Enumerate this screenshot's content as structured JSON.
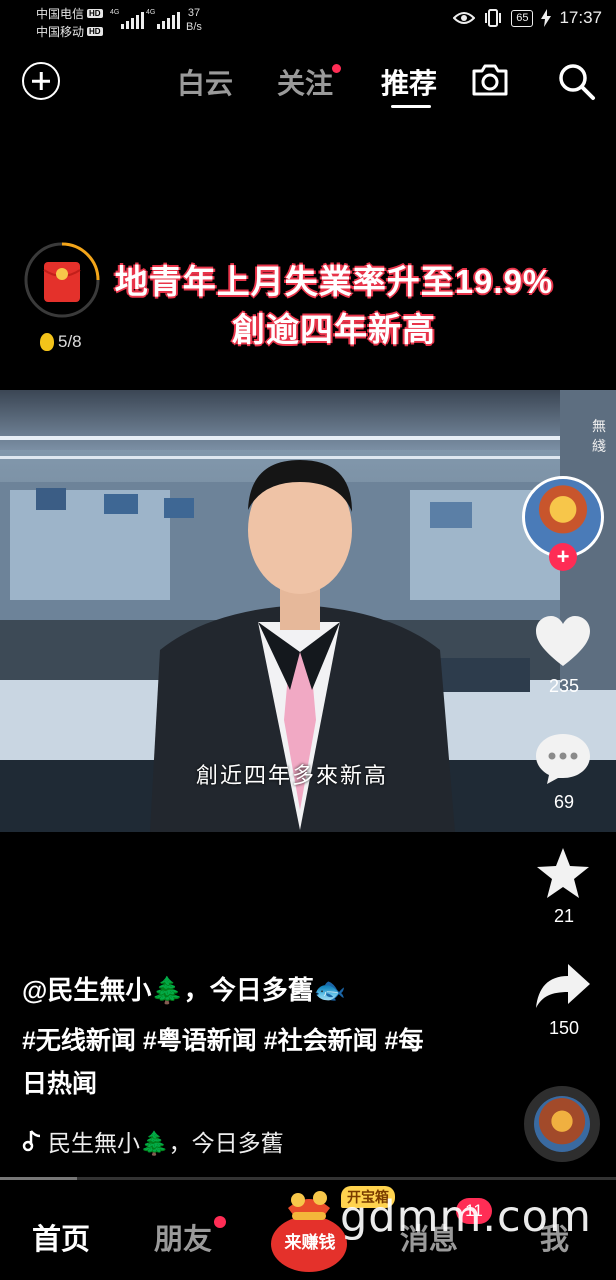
{
  "status_bar": {
    "carrier1": "中国电信",
    "carrier2": "中国移动",
    "hd_label": "HD",
    "network_tag": "4G",
    "net_speed_value": "37",
    "net_speed_unit": "B/s",
    "battery": "65",
    "time": "17:37"
  },
  "top_nav": {
    "tabs": [
      {
        "label": "白云",
        "active": false,
        "dot": false
      },
      {
        "label": "关注",
        "active": false,
        "dot": true
      },
      {
        "label": "推荐",
        "active": true,
        "dot": false
      }
    ]
  },
  "video": {
    "headline_line1": "地青年上月失業率升至19.9%",
    "headline_line2": "創逾四年新高",
    "coin_progress": "5/8",
    "subtitle": "創近四年多來新高",
    "channel_text": "無綫"
  },
  "actions": {
    "likes": "235",
    "comments": "69",
    "favorites": "21",
    "shares": "150",
    "follow_symbol": "+"
  },
  "caption": {
    "author": "@民生無小🌲，今日多舊🐟",
    "hashtags": "#无线新闻 #粤语新闻 #社会新闻 #每日热闻",
    "music": "民生無小🌲，今日多舊"
  },
  "playback": {
    "progress_fraction": 0.125
  },
  "bottom_nav": {
    "tabs": [
      {
        "label": "首页",
        "active": true
      },
      {
        "label": "朋友",
        "active": false,
        "dot": true
      },
      {
        "label": "消息",
        "active": false
      },
      {
        "label": "我",
        "active": false
      }
    ],
    "earn_label": "来赚钱",
    "treasure_label": "开宝箱",
    "messages_badge": "11"
  },
  "watermark": "gdmm.com",
  "colors": {
    "accent_red": "#fe2c55",
    "headline_outline": "#e8344a",
    "inactive_gray": "#9a9a9a"
  }
}
